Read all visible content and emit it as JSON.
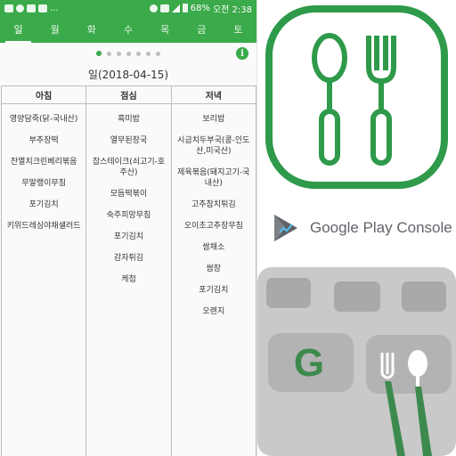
{
  "status_bar": {
    "notif_more": "...",
    "battery": "68%",
    "time_label": "오전 2:38"
  },
  "tabs": [
    {
      "label": "일",
      "active": true
    },
    {
      "label": "월"
    },
    {
      "label": "화"
    },
    {
      "label": "수"
    },
    {
      "label": "목"
    },
    {
      "label": "금"
    },
    {
      "label": "토"
    }
  ],
  "pager": {
    "page_count": 7,
    "current": 1
  },
  "info_glyph": "i",
  "date_title": "일(2018-04-15)",
  "meals": [
    {
      "title": "아침",
      "items": [
        "영양담죽(닭-국내산)",
        "부추장떡",
        "잔멸치크린베리볶음",
        "무말랭이무침",
        "포기김치",
        "키위드레싱야채샐러드"
      ]
    },
    {
      "title": "점심",
      "items": [
        "흑미밥",
        "열무된장국",
        "찹스테이크(쇠고기-호주산)",
        "모듬떡볶이",
        "숙주피망무침",
        "포기김치",
        "감자튀김",
        "케첩"
      ]
    },
    {
      "title": "저녁",
      "items": [
        "보리밥",
        "시금치두부국(콩-인도산,미국산)",
        "제육볶음(돼지고기-국내산)",
        "고추참치튀김",
        "오이초고추장무침",
        "쌈채소",
        "쌈장",
        "포기김치",
        "오렌지"
      ]
    }
  ],
  "play_console": {
    "text": "Google Play Console"
  },
  "tray_logo": {
    "letter": "G"
  },
  "colors": {
    "brand_green": "#3aaa4a",
    "icon_green": "#2e9a4a",
    "tray_green": "#3d8a4e",
    "tray_gray": "#c9c9c9"
  }
}
